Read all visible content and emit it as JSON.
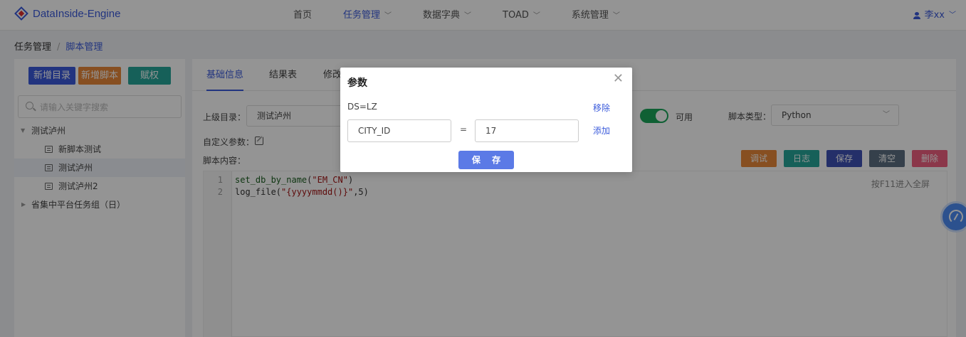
{
  "app": {
    "title": "DataInside-Engine"
  },
  "nav": {
    "items": [
      {
        "label": "首页",
        "dropdown": false
      },
      {
        "label": "任务管理",
        "dropdown": true
      },
      {
        "label": "数据字典",
        "dropdown": true
      },
      {
        "label": "TOAD",
        "dropdown": true
      },
      {
        "label": "系统管理",
        "dropdown": true
      }
    ],
    "user": "李xx"
  },
  "breadcrumb": {
    "root": "任务管理",
    "sep": "/",
    "current": "脚本管理"
  },
  "sidebar": {
    "buttons": {
      "new_dir": "新增目录",
      "new_script": "新增脚本",
      "grant": "赋权"
    },
    "search_placeholder": "请输入关键字搜索",
    "tree": [
      {
        "label": "测试泸州",
        "expanded": true
      },
      {
        "label": "新脚本测试"
      },
      {
        "label": "测试泸州",
        "selected": true
      },
      {
        "label": "测试泸州2"
      },
      {
        "label": "省集中平台任务组（日）",
        "expanded": false
      }
    ]
  },
  "main": {
    "tabs": [
      "基础信息",
      "结果表",
      "修改"
    ],
    "active_tab": "基础信息",
    "form": {
      "parent_dir_label": "上级目录：",
      "parent_dir_value": "测试泸州",
      "enabled_label": "可用",
      "enabled": true,
      "script_type_label": "脚本类型：",
      "script_type_value": "Python",
      "custom_params_label": "自定义参数：",
      "content_label": "脚本内容："
    },
    "actions": {
      "debug": "调试",
      "log": "日志",
      "save": "保存",
      "clear": "清空",
      "delete": "删除"
    },
    "editor": {
      "hint": "按F11进入全屏",
      "lines": [
        {
          "no": "1",
          "fn": "set_db_by_name",
          "open": "(",
          "str": "\"EM_CN\"",
          "rest": ")"
        },
        {
          "no": "2",
          "fn": "log_file",
          "open": "(",
          "str": "\"{yyyymmdd()}\"",
          "rest": ",5)"
        }
      ]
    }
  },
  "modal": {
    "title": "参数",
    "existing_param": "DS=LZ",
    "remove_label": "移除",
    "key_value": "CITY_ID",
    "eq": "=",
    "value_value": "17",
    "add_label": "添加",
    "save_label": "保 存"
  },
  "colors": {
    "primary": "#3b5bdb",
    "orange": "#e8883a",
    "teal": "#26a69a",
    "navy": "#3f51b5",
    "slate": "#5c6f82",
    "pink": "#f06080",
    "green": "#1ba55a"
  },
  "icons": {
    "logo": "diamond-logo-icon",
    "search": "search-icon",
    "edit": "edit-icon",
    "close": "close-icon",
    "float": "speed-dial-icon"
  }
}
